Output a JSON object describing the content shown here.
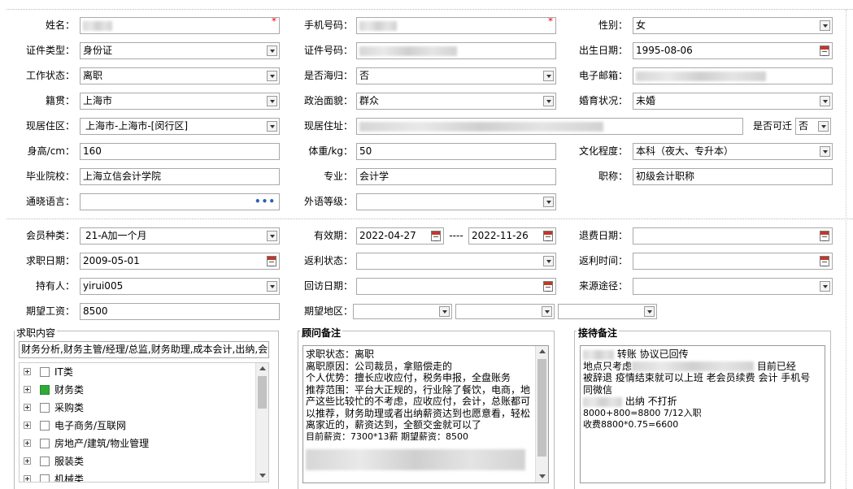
{
  "personal": {
    "name_label": "姓名：",
    "mobile_label": "手机号码：",
    "gender_label": "性别：",
    "gender": "女",
    "id_type_label": "证件类型：",
    "id_type": "身份证",
    "id_no_label": "证件号码：",
    "birth_label": "出生日期：",
    "birth": "1995-08-06",
    "work_status_label": "工作状态：",
    "work_status": "离职",
    "returnee_label": "是否海归：",
    "returnee": "否",
    "email_label": "电子邮箱：",
    "native_label": "籍贯：",
    "native": "上海市",
    "political_label": "政治面貌：",
    "political": "群众",
    "marital_label": "婚育状况：",
    "marital": "未婚",
    "residence_area_label": "现居住区：",
    "residence_area": "上海市-上海市-[闵行区]",
    "address_label": "现居住址：",
    "relocate_label": "是否可迁",
    "relocate": "否",
    "height_label": "身高/cm：",
    "height": "160",
    "weight_label": "体重/kg：",
    "weight": "50",
    "education_label": "文化程度：",
    "education": "本科（夜大、专升本）",
    "school_label": "毕业院校：",
    "school": "上海立信会计学院",
    "major_label": "专业：",
    "major": "会计学",
    "title_label": "职称：",
    "title": "初级会计职称",
    "language_label": "通晓语言：",
    "lang_level_label": "外语等级："
  },
  "membership": {
    "type_label": "会员种类：",
    "type": "21-A加一个月",
    "valid_label": "有效期：",
    "valid_from": "2022-04-27",
    "valid_sep": "----",
    "valid_to": "2022-11-26",
    "refund_date_label": "退费日期：",
    "job_date_label": "求职日期：",
    "job_date": "2009-05-01",
    "rebate_status_label": "返利状态：",
    "rebate_time_label": "返利时间：",
    "holder_label": "持有人：",
    "holder": "yirui005",
    "visit_date_label": "回访日期：",
    "source_label": "来源途径：",
    "salary_label": "期望工资：",
    "salary": "8500",
    "region_label": "期望地区："
  },
  "job_content": {
    "title": "求职内容",
    "summary": "财务分析,财务主管/经理/总监,财务助理,成本会计,出纳,会计",
    "categories": [
      {
        "label": "IT类",
        "checked": false
      },
      {
        "label": "财务类",
        "checked": true
      },
      {
        "label": "采购类",
        "checked": false
      },
      {
        "label": "电子商务/互联网",
        "checked": false
      },
      {
        "label": "房地产/建筑/物业管理",
        "checked": false
      },
      {
        "label": "服装类",
        "checked": false
      },
      {
        "label": "机械类",
        "checked": false
      }
    ]
  },
  "consultant_note": {
    "title": "顾问备注",
    "lines": [
      "求职状态：离职",
      "离职原因：公司裁员，拿赔偿走的",
      "个人优势：擅长应收应付，税务申报，全盘账务",
      "推荐范围：平台大正规的，行业除了餐饮，电商，地",
      "产这些比较忙的不考虑，应收应付，会计，总账都可",
      "以推荐，财务助理或者出纳薪资达到也愿意看，轻松",
      "离家近的，薪资达到，全额交金就可以了",
      "目前薪资：7300*13薪      期望薪资：8500"
    ]
  },
  "reception_note": {
    "title": "接待备注",
    "lines": [
      "转账 协议已回传",
      "地点只考虑",
      "目前已经",
      "被辞退 疫情结束就可以上班 老会员续费 会计 手机号",
      "同微信",
      "出纳 不打折",
      "8000+800=8800   7/12入职",
      "收费8800*0.75=6600"
    ]
  }
}
